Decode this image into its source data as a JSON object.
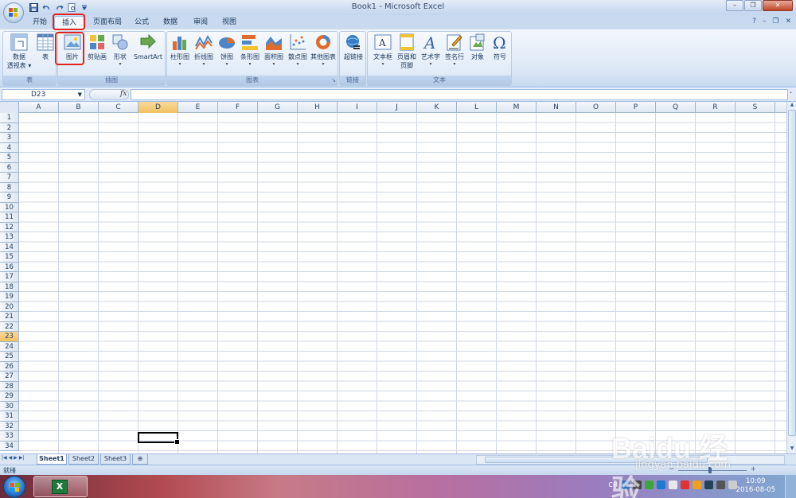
{
  "window": {
    "title": "Book1 - Microsoft Excel",
    "controls": [
      "–",
      "❐",
      "✕"
    ]
  },
  "qat": {
    "items": [
      "save-icon",
      "undo-icon",
      "redo-icon",
      "print-preview-icon",
      "customize-icon"
    ]
  },
  "tabs": [
    {
      "label": "开始",
      "active": false
    },
    {
      "label": "插入",
      "active": true
    },
    {
      "label": "页面布局",
      "active": false
    },
    {
      "label": "公式",
      "active": false
    },
    {
      "label": "数据",
      "active": false
    },
    {
      "label": "审阅",
      "active": false
    },
    {
      "label": "视图",
      "active": false
    }
  ],
  "tab_right": {
    "help": "?",
    "min": "–",
    "restore": "❐",
    "close": "✕"
  },
  "ribbon": {
    "groups": [
      {
        "label": "表",
        "buttons": [
          {
            "label1": "数据",
            "label2": "透视表 ▾",
            "icon": "pivot-table-icon"
          },
          {
            "label1": "表",
            "label2": "",
            "icon": "table-icon"
          }
        ]
      },
      {
        "label": "插图",
        "buttons": [
          {
            "label1": "图片",
            "icon": "picture-icon"
          },
          {
            "label1": "剪贴画",
            "icon": "clip-art-icon"
          },
          {
            "label1": "形状",
            "dd": "▾",
            "icon": "shapes-icon"
          },
          {
            "label1": "SmartArt",
            "icon": "smartart-icon"
          }
        ]
      },
      {
        "label": "图表",
        "buttons": [
          {
            "label1": "柱形图",
            "dd": "▾",
            "icon": "column-chart-icon"
          },
          {
            "label1": "折线图",
            "dd": "▾",
            "icon": "line-chart-icon"
          },
          {
            "label1": "饼图",
            "dd": "▾",
            "icon": "pie-chart-icon"
          },
          {
            "label1": "条形图",
            "dd": "▾",
            "icon": "bar-chart-icon"
          },
          {
            "label1": "面积图",
            "dd": "▾",
            "icon": "area-chart-icon"
          },
          {
            "label1": "散点图",
            "dd": "▾",
            "icon": "scatter-chart-icon"
          },
          {
            "label1": "其他图表",
            "dd": "▾",
            "icon": "other-charts-icon"
          }
        ]
      },
      {
        "label": "链接",
        "buttons": [
          {
            "label1": "超链接",
            "icon": "hyperlink-icon"
          }
        ]
      },
      {
        "label": "文本",
        "buttons": [
          {
            "label1": "文本框",
            "dd": "▾",
            "icon": "text-box-icon"
          },
          {
            "label1": "页眉和",
            "label2": "页脚",
            "icon": "header-footer-icon"
          },
          {
            "label1": "艺术字",
            "dd": "▾",
            "icon": "wordart-icon"
          },
          {
            "label1": "签名行",
            "dd": "▾",
            "icon": "signature-line-icon"
          },
          {
            "label1": "对象",
            "icon": "object-icon"
          },
          {
            "label1": "符号",
            "icon": "symbol-icon"
          }
        ]
      }
    ],
    "launcher": "↘"
  },
  "formula_bar": {
    "name_box": "D23",
    "fx": "fx",
    "value": ""
  },
  "grid": {
    "columns": [
      "A",
      "B",
      "C",
      "D",
      "E",
      "F",
      "G",
      "H",
      "I",
      "J",
      "K",
      "L",
      "M",
      "N",
      "O",
      "P",
      "Q",
      "R",
      "S"
    ],
    "rows": [
      "1",
      "2",
      "3",
      "4",
      "5",
      "6",
      "7",
      "8",
      "9",
      "10",
      "11",
      "12",
      "13",
      "14",
      "15",
      "16",
      "17",
      "18",
      "19",
      "20",
      "21",
      "22",
      "23",
      "24",
      "25",
      "26",
      "27",
      "28",
      "29",
      "30",
      "31",
      "32",
      "33",
      "34"
    ],
    "selected_column": "D",
    "selected_row": "23"
  },
  "sheets": [
    {
      "label": "Sheet1",
      "active": true
    },
    {
      "label": "Sheet2",
      "active": false
    },
    {
      "label": "Sheet3",
      "active": false
    }
  ],
  "sheet_nav": [
    "|◀",
    "◀",
    "▶",
    "▶|"
  ],
  "status": {
    "text": "就绪"
  },
  "taskbar": {
    "tray_lang": "CH",
    "time": "10:09",
    "date": "2016-08-05",
    "excel_letter": "X"
  },
  "watermark": {
    "main": "Baidu 经验",
    "url": "jingyan.baidu.com"
  },
  "colors": {
    "highlight": "#e0241b",
    "ribbon_bg": "#dce8f6",
    "selected_header": "#f1c15f"
  }
}
